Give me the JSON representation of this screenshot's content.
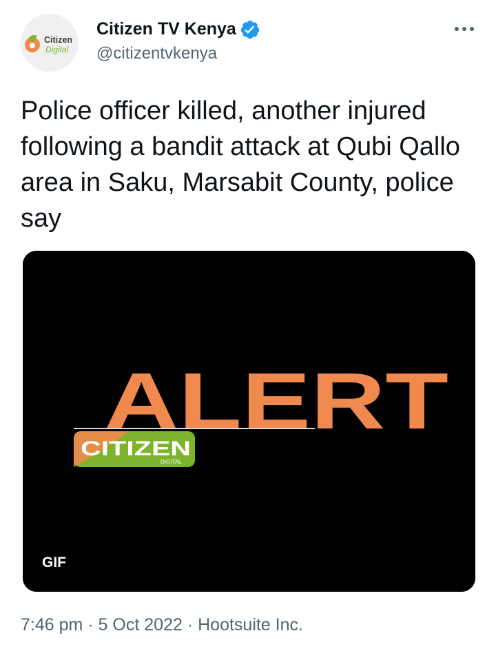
{
  "author": {
    "display_name": "Citizen TV Kenya",
    "handle": "@citizentvkenya",
    "avatar_text_line1": "Citizen",
    "avatar_text_line2": "Digital",
    "verified_icon": "verified-badge-icon"
  },
  "tweet": {
    "text": "Police officer killed, another injured following a bandit attack at Qubi Qallo area in Saku, Marsabit County, police say"
  },
  "media": {
    "headline": "ALERT",
    "logo_text": "CITIZEN",
    "logo_subtext": "DIGITAL",
    "badge": "GIF"
  },
  "meta": {
    "time": "7:46 pm",
    "separator": "·",
    "date": "5 Oct 2022",
    "source": "Hootsuite Inc."
  },
  "colors": {
    "accent_orange": "#F0894E",
    "logo_green": "#7DB42B",
    "verified_blue": "#1D9BF0",
    "secondary_text": "#536471"
  }
}
